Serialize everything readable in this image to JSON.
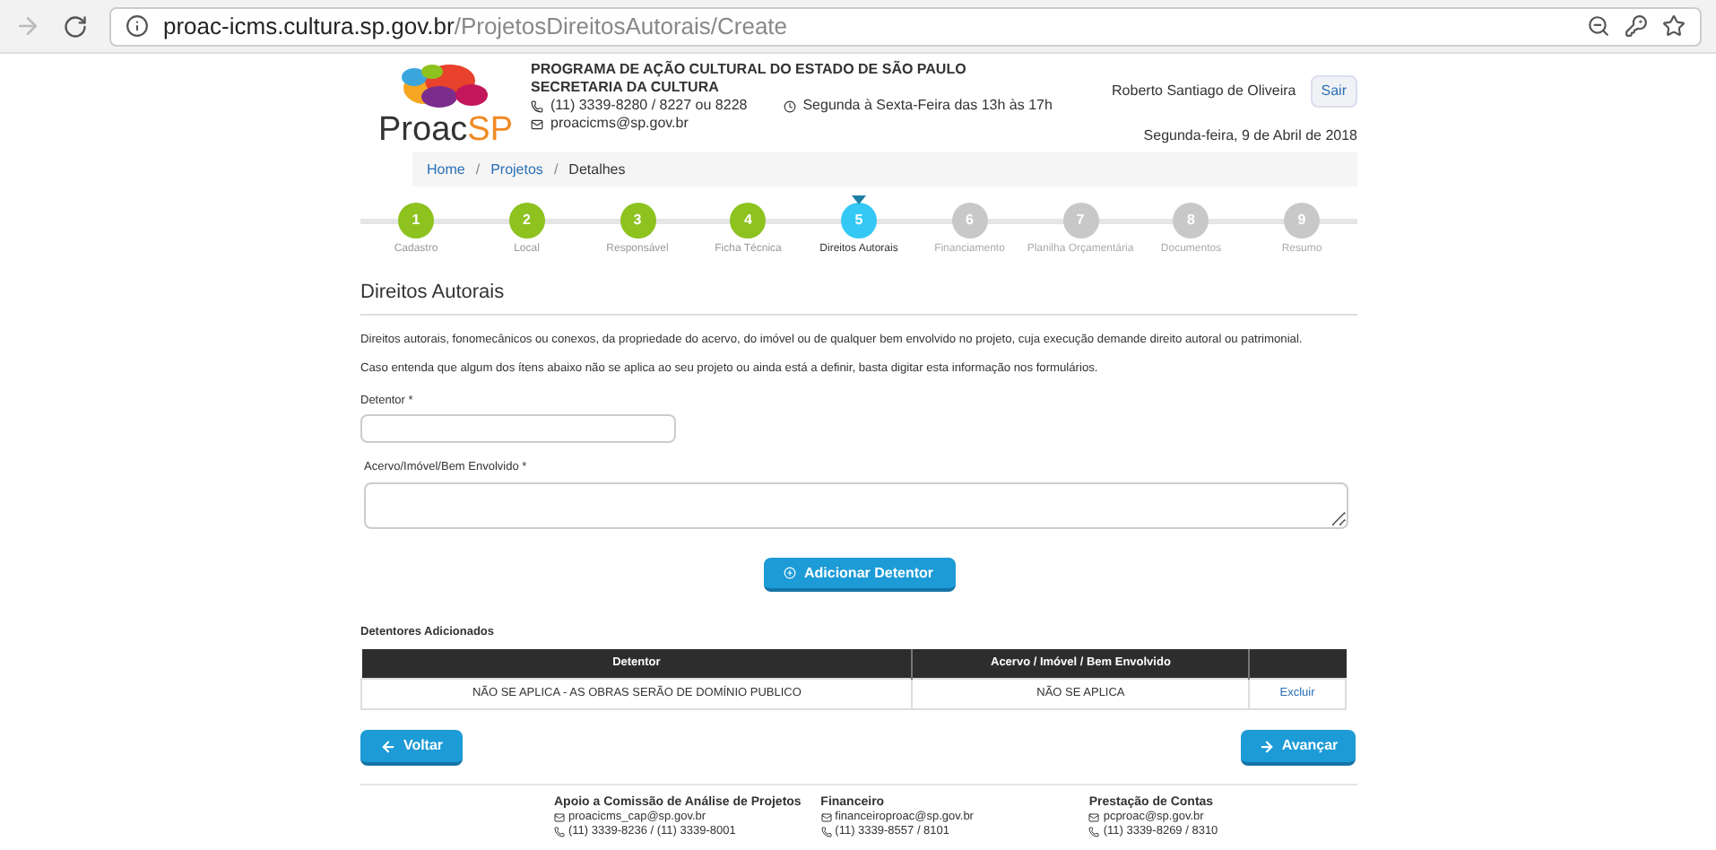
{
  "browser": {
    "url_host": "proac-icms.cultura.sp.gov.br",
    "url_path": "/ProjetosDireitosAutorais/Create"
  },
  "header": {
    "logo_a": "Proac",
    "logo_b": "SP",
    "org": "PROGRAMA DE AÇÃO CULTURAL DO ESTADO DE SÃO PAULO",
    "dept": "SECRETARIA DA CULTURA",
    "phone": "(11) 3339-8280 / 8227 ou 8228",
    "hours": "Segunda à Sexta-Feira das 13h às 17h",
    "email": "proacicms@sp.gov.br",
    "user": "Roberto Santiago de Oliveira",
    "logout": "Sair",
    "date": "Segunda-feira, 9 de Abril de 2018"
  },
  "breadcrumb_separator": "/",
  "breadcrumb": [
    {
      "label": "Home",
      "link": true
    },
    {
      "label": "Projetos",
      "link": true
    },
    {
      "label": "Detalhes",
      "link": false
    }
  ],
  "steps": [
    {
      "number": "1",
      "label": "Cadastro",
      "completed": true,
      "selected": false
    },
    {
      "number": "2",
      "label": "Local",
      "completed": true,
      "selected": false
    },
    {
      "number": "3",
      "label": "Responsável",
      "completed": true,
      "selected": false
    },
    {
      "number": "4",
      "label": "Ficha Técnica",
      "completed": true,
      "selected": false
    },
    {
      "number": "5",
      "label": "Direitos Autorais",
      "completed": false,
      "selected": true
    },
    {
      "number": "6",
      "label": "Financiamento",
      "completed": false,
      "selected": false
    },
    {
      "number": "7",
      "label": "Planilha Orçamentária",
      "completed": false,
      "selected": false
    },
    {
      "number": "8",
      "label": "Documentos",
      "completed": false,
      "selected": false
    },
    {
      "number": "9",
      "label": "Resumo",
      "completed": false,
      "selected": false
    }
  ],
  "section_title": "Direitos Autorais",
  "paragraphs": [
    "Direitos autorais, fonomecânicos ou conexos, da propriedade do acervo, do imóvel ou de qualquer bem envolvido no projeto, cuja execução demande direito autoral ou patrimonial.",
    "Caso entenda que algum dos ítens abaixo não se aplica ao seu projeto ou ainda está a definir, basta digitar esta informação nos formulários."
  ],
  "fields": [
    {
      "label": "Detentor *"
    },
    {
      "label": "Acervo/Imóvel/Bem Envolvido *"
    }
  ],
  "add_button": "Adicionar Detentor",
  "table": {
    "title": "Detentores Adicionados",
    "columns": [
      "Detentor",
      "Acervo / Imóvel / Bem Envolvido"
    ],
    "rows": [
      {
        "cells": [
          "NÃO SE APLICA - AS OBRAS SERÃO DE DOMÍNIO PUBLICO",
          "NÃO SE APLICA"
        ],
        "action": "Excluir"
      }
    ]
  },
  "back_button": "Voltar",
  "next_button": "Avançar",
  "footer": [
    {
      "title": "Apoio a Comissão de Análise de Projetos",
      "email": "proacicms_cap@sp.gov.br",
      "phone": "(11) 3339-8236 / (11) 3339-8001"
    },
    {
      "title": "Financeiro",
      "email": "financeiroproac@sp.gov.br",
      "phone": "(11) 3339-8557 / 8101"
    },
    {
      "title": "Prestação de Contas",
      "email": "pcproac@sp.gov.br",
      "phone": "(11) 3339-8269 / 8310"
    }
  ]
}
